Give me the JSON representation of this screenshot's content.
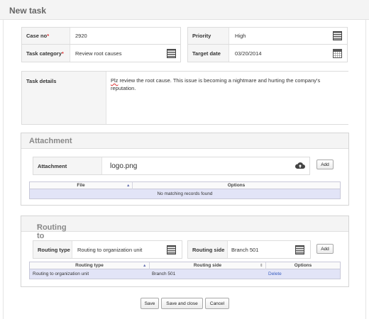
{
  "header": {
    "title": "New task"
  },
  "form": {
    "case_no": {
      "label": "Case no",
      "required_mark": "*",
      "value": "2920"
    },
    "task_category": {
      "label": "Task category",
      "required_mark": "*",
      "value": "Review root causes"
    },
    "priority": {
      "label": "Priority",
      "value": "High"
    },
    "target_date": {
      "label": "Target date",
      "value": "03/20/2014"
    },
    "task_details": {
      "label": "Task details",
      "misspelled_word": "Plz",
      "text_rest": " review the root cause. This issue is becoming a nightmare and hurting the company's reputation."
    }
  },
  "attachment": {
    "section_title": "Attachment",
    "field_label": "Attachment",
    "file_value": "logo.png",
    "add_button": "Add",
    "grid": {
      "columns": [
        "File",
        "Options"
      ],
      "empty_message": "No matching records found"
    }
  },
  "routing": {
    "section_title": "Routing to",
    "required_mark": "*",
    "routing_type": {
      "label": "Routing type",
      "value": "Routing to organization unit"
    },
    "routing_side": {
      "label": "Routing side",
      "value": "Branch 501"
    },
    "add_button": "Add",
    "grid": {
      "columns": [
        "Routing type",
        "Routing side",
        "Options"
      ],
      "rows": [
        {
          "routing_type": "Routing to organization unit",
          "routing_side": "Branch 501",
          "option": "Delete"
        }
      ]
    }
  },
  "footer": {
    "save": "Save",
    "save_and_close": "Save and close",
    "cancel": "Cancel"
  },
  "colors": {
    "required": "#dd3333",
    "link": "#3b5fc0",
    "grid_row": "#e2e4f7",
    "section_title": "#888888"
  },
  "icons": [
    "list-picker-icon",
    "calendar-icon",
    "cloud-upload-icon",
    "sort-asc-icon",
    "sort-icon"
  ]
}
